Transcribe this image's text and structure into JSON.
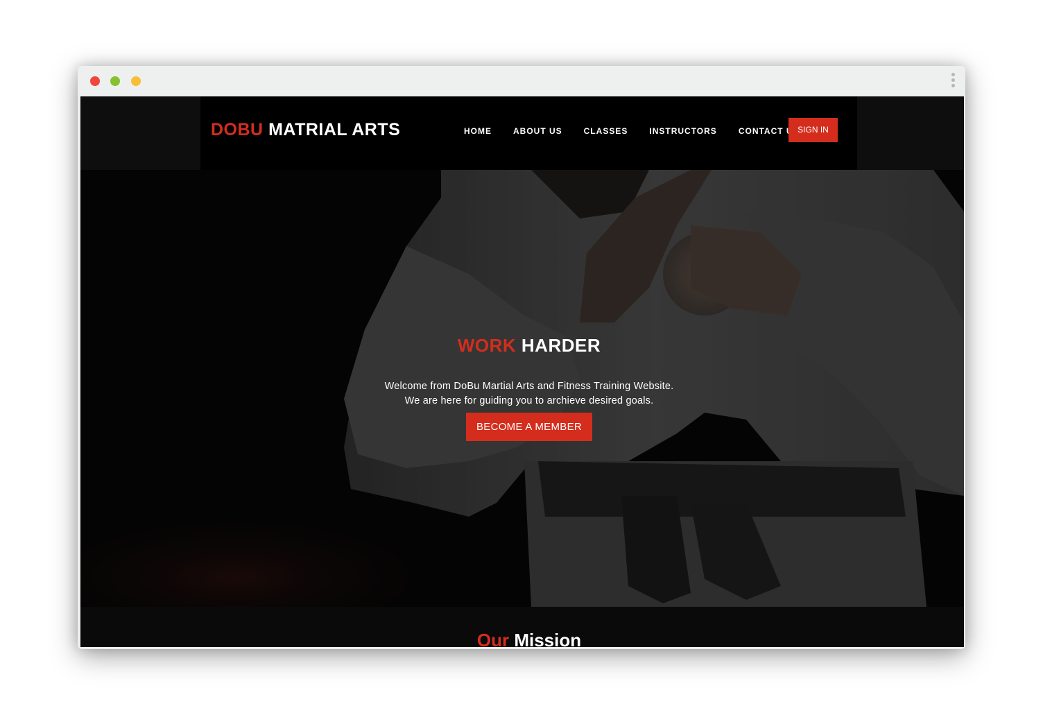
{
  "window": {
    "controls": [
      "close",
      "minimize",
      "zoom"
    ],
    "menu_icon": "kebab-menu-icon"
  },
  "brand": {
    "accent": "#d42d1d",
    "logo_accent": "DOBU",
    "logo_rest": "MATRIAL ARTS"
  },
  "nav": {
    "items": [
      {
        "label": "HOME"
      },
      {
        "label": "ABOUT US"
      },
      {
        "label": "CLASSES"
      },
      {
        "label": "INSTRUCTORS"
      },
      {
        "label": "CONTACT US"
      }
    ],
    "signin_label": "SIGN IN"
  },
  "hero": {
    "title_accent": "WORK",
    "title_rest": "HARDER",
    "line1": "Welcome from DoBu Martial Arts and Fitness Training Website.",
    "line2": "We are here for guiding you to archieve desired goals.",
    "cta_label": "BECOME A MEMBER"
  },
  "mission": {
    "title_accent": "Our",
    "title_rest": "Mission"
  }
}
